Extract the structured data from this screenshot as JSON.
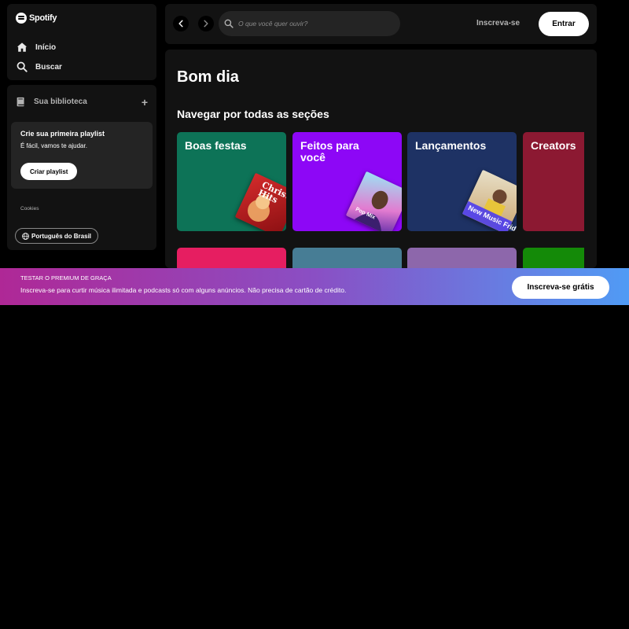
{
  "sidebar": {
    "logo_text": "Spotify",
    "nav": [
      {
        "label": "Início",
        "icon": "home-icon"
      },
      {
        "label": "Buscar",
        "icon": "search-icon"
      }
    ],
    "library": {
      "title": "Sua biblioteca",
      "add_icon": "plus-icon",
      "create_card": {
        "title": "Crie sua primeira playlist",
        "subtitle": "É fácil, vamos te ajudar.",
        "button": "Criar playlist"
      },
      "cookies": "Cookies",
      "language_button": "Português do Brasil"
    }
  },
  "topbar": {
    "search_placeholder": "O que você quer ouvir?",
    "signup": "Inscreva-se",
    "login": "Entrar"
  },
  "main": {
    "greeting": "Bom dia",
    "section_title": "Navegar por todas as seções",
    "cards": [
      {
        "label": "Boas festas",
        "color": "#0d7357",
        "art_text": "Christmas Hits"
      },
      {
        "label": "Feitos para você",
        "color": "#8d07f6",
        "art_text": "Pop Mix"
      },
      {
        "label": "Lançamentos",
        "color": "#1e3264",
        "art_text": "New Music Friday"
      },
      {
        "label": "Creators",
        "color": "#8c1932",
        "art_text": ""
      }
    ],
    "second_row_colors": [
      "#e61e61",
      "#477d95",
      "#8d67ab",
      "#148a08"
    ]
  },
  "banner": {
    "title": "TESTAR O PREMIUM DE GRAÇA",
    "subtitle": "Inscreva-se para curtir música ilimitada e podcasts só com alguns anúncios. Não precisa de cartão de crédito.",
    "button": "Inscreva-se grátis"
  },
  "colors": {
    "background": "#000000",
    "panel": "#121212",
    "card_dark": "#242424",
    "banner_gradient": [
      "#af2896",
      "#509bf5"
    ]
  }
}
